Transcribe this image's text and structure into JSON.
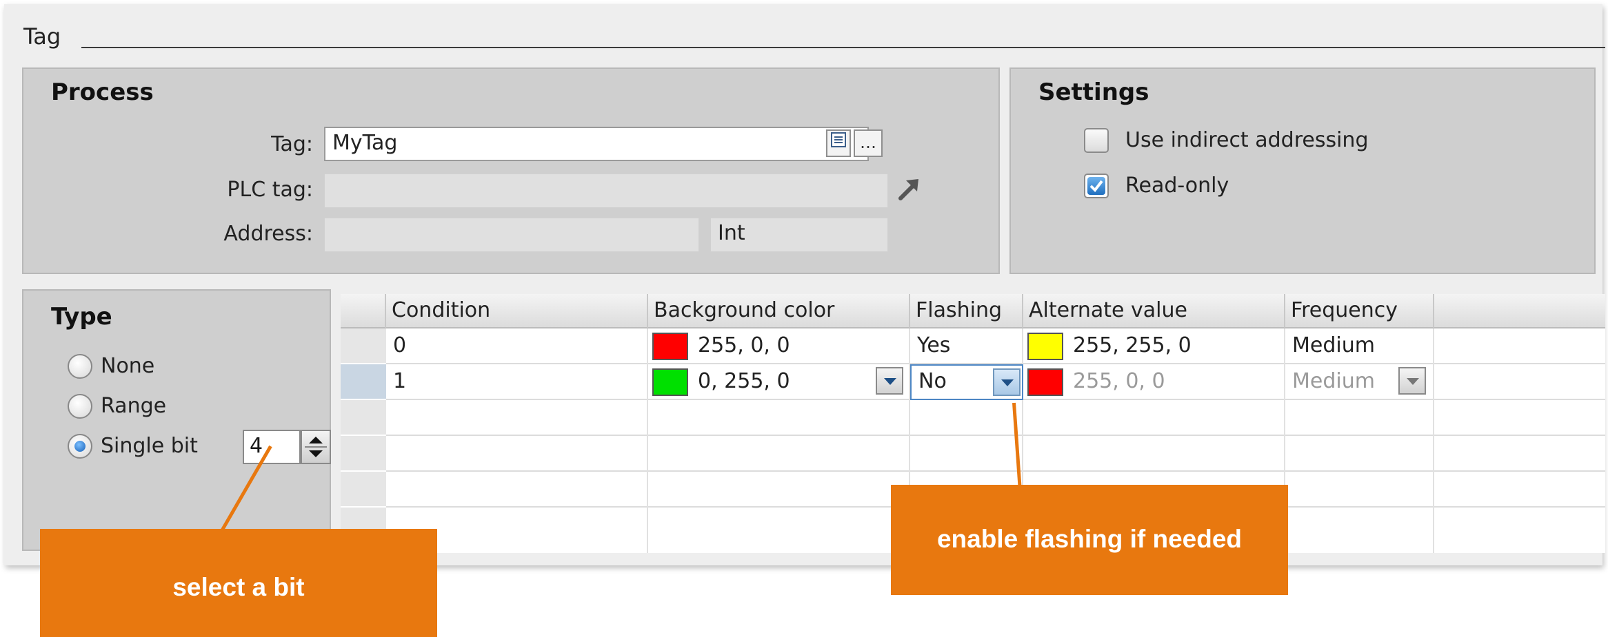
{
  "section_header": "Tag",
  "process": {
    "title": "Process",
    "tag_label": "Tag:",
    "tag_value": "MyTag",
    "plc_tag_label": "PLC tag:",
    "plc_tag_value": "",
    "address_label": "Address:",
    "address_value": "",
    "address_type": "Int"
  },
  "settings": {
    "title": "Settings",
    "indirect_label": "Use indirect addressing",
    "indirect_checked": false,
    "readonly_label": "Read-only",
    "readonly_checked": true
  },
  "type": {
    "title": "Type",
    "options": [
      "None",
      "Range",
      "Single bit"
    ],
    "selected": "Single bit",
    "bit_value": "4"
  },
  "table": {
    "columns": [
      "Condition",
      "Background color",
      "Flashing",
      "Alternate value",
      "Frequency"
    ],
    "rows": [
      {
        "condition": "0",
        "bg_color_rgb": "255, 0, 0",
        "bg_color": "#ff0000",
        "flashing": "Yes",
        "alt_rgb": "255, 255, 0",
        "alt_color": "#ffff00",
        "frequency": "Medium"
      },
      {
        "condition": "1",
        "bg_color_rgb": "0, 255, 0",
        "bg_color": "#00e000",
        "flashing": "No",
        "alt_rgb": "255, 0, 0",
        "alt_color": "#ff0000",
        "frequency": "Medium"
      }
    ]
  },
  "callouts": {
    "bit": "select a bit",
    "flashing": "enable flashing if needed"
  },
  "colors": {
    "accent_orange": "#e8780f",
    "group_bg": "#cfcfcf",
    "panel_bg": "#eeeeee"
  }
}
